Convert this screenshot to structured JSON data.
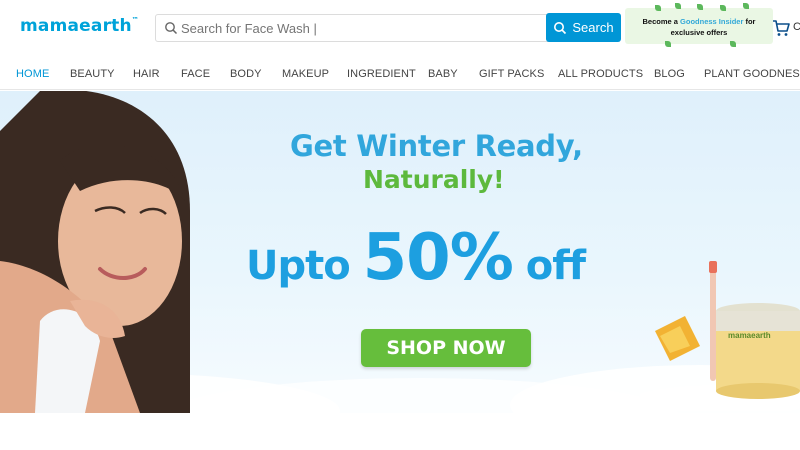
{
  "header": {
    "logo_text": "mamaearth",
    "logo_tm": "™",
    "search": {
      "placeholder": "Search for Face Wash |",
      "button_label": "Search"
    },
    "promo": {
      "line1_prefix": "Become a ",
      "line1_accent": "Goodness Insider",
      "line1_suffix": " for",
      "line2": "exclusive offers"
    },
    "cart_label": "C"
  },
  "nav": {
    "items": [
      {
        "label": "HOME",
        "active": true
      },
      {
        "label": "BEAUTY"
      },
      {
        "label": "HAIR"
      },
      {
        "label": "FACE"
      },
      {
        "label": "BODY"
      },
      {
        "label": "MAKEUP"
      },
      {
        "label": "INGREDIENT"
      },
      {
        "label": "BABY"
      },
      {
        "label": "GIFT PACKS"
      },
      {
        "label": "ALL PRODUCTS"
      },
      {
        "label": "BLOG"
      },
      {
        "label": "PLANT GOODNESS"
      }
    ]
  },
  "banner": {
    "headline1": "Get Winter Ready,",
    "headline2": "Naturally!",
    "offer_prefix": "Upto ",
    "offer_value": "50%",
    "offer_suffix": " off",
    "cta_label": "SHOP NOW",
    "product_brand": "mamaearth"
  },
  "colors": {
    "brand": "#00a3d9",
    "search_button": "#0096d6",
    "cta": "#66be3c",
    "headline_blue": "#31a6dc",
    "headline_green": "#5db93d"
  },
  "icons": [
    "search-icon",
    "cart-icon",
    "leaf-icon"
  ]
}
